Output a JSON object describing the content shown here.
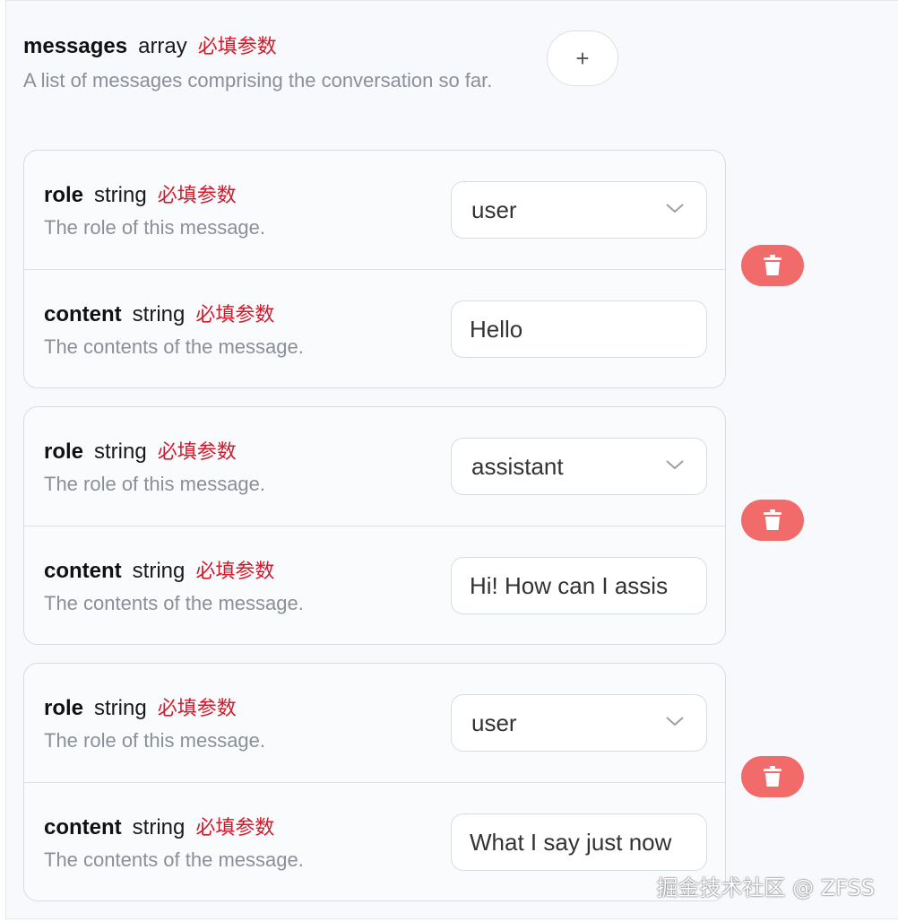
{
  "messages_param": {
    "name": "messages",
    "type": "array",
    "required_label": "必填参数",
    "description": "A list of messages comprising the conversation so far.",
    "add_button_label": "+"
  },
  "items": [
    {
      "role": {
        "name": "role",
        "type": "string",
        "required_label": "必填参数",
        "description": "The role of this message.",
        "value": "user"
      },
      "content": {
        "name": "content",
        "type": "string",
        "required_label": "必填参数",
        "description": "The contents of the message.",
        "value": "Hello"
      }
    },
    {
      "role": {
        "name": "role",
        "type": "string",
        "required_label": "必填参数",
        "description": "The role of this message.",
        "value": "assistant"
      },
      "content": {
        "name": "content",
        "type": "string",
        "required_label": "必填参数",
        "description": "The contents of the message.",
        "value": "Hi! How can I assis"
      }
    },
    {
      "role": {
        "name": "role",
        "type": "string",
        "required_label": "必填参数",
        "description": "The role of this message.",
        "value": "user"
      },
      "content": {
        "name": "content",
        "type": "string",
        "required_label": "必填参数",
        "description": "The contents of the message.",
        "value": "What I say just now"
      }
    }
  ],
  "icons": {
    "select": "chevron-down-icon",
    "delete": "trash-icon"
  },
  "colors": {
    "required": "#d11a2a",
    "delete_button": "#f26b6b",
    "panel_bg": "#f8f9fc",
    "description": "#8a8f98"
  },
  "watermark": "掘金技术社区 @ ZFSS"
}
